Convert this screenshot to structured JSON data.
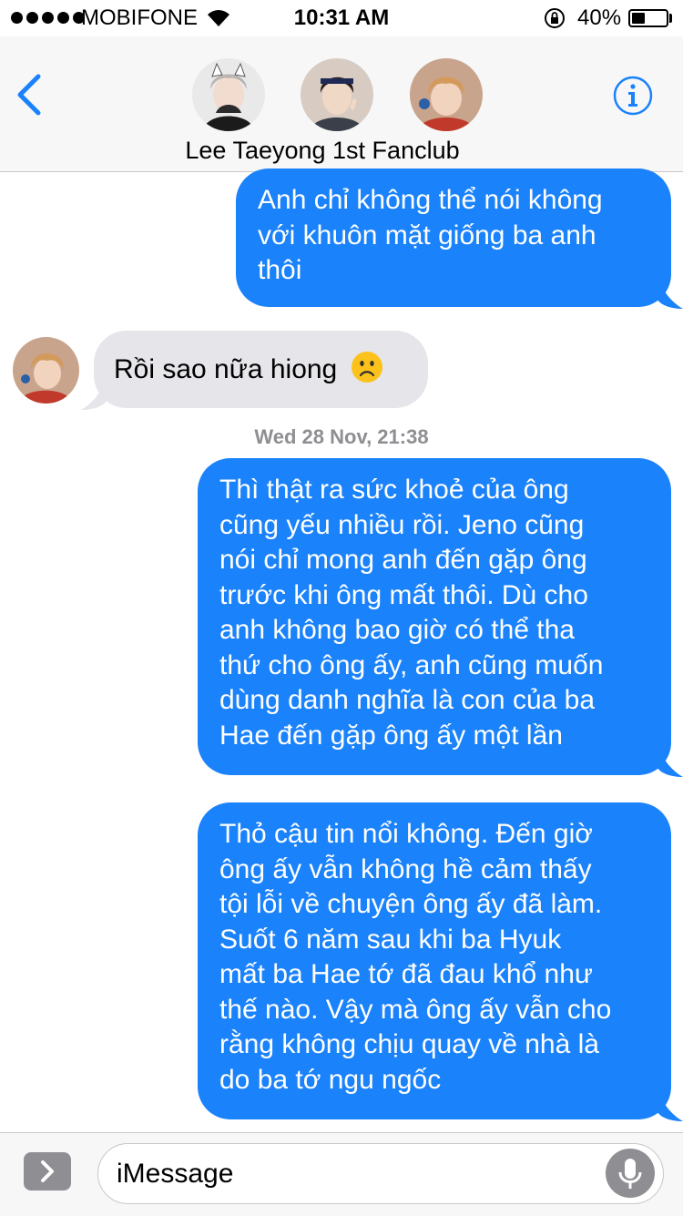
{
  "status_bar": {
    "carrier": "MOBIFONE",
    "time": "10:31 AM",
    "battery": "40%",
    "battery_level": 0.4
  },
  "header": {
    "group_name": "Lee Taeyong 1st Fanclub",
    "back_icon": "chevron-left-icon",
    "info_icon": "info-icon",
    "accent_color": "#1a82fb"
  },
  "messages": [
    {
      "direction": "outgoing",
      "lines": [
        "Anh chỉ không thể nói không",
        "với khuôn mặt giống ba anh",
        "thôi"
      ]
    },
    {
      "direction": "incoming",
      "text": "Rồi sao nữa hiong",
      "emoji": "frowning-face"
    },
    {
      "timestamp": "Wed 28 Nov, 21:38"
    },
    {
      "direction": "outgoing",
      "lines": [
        "Thì thật ra sức khoẻ của ông",
        "cũng yếu nhiều rồi. Jeno cũng",
        "nói chỉ mong anh đến gặp ông",
        "trước khi ông mất thôi. Dù cho",
        "anh không bao giờ có thể tha",
        "thứ cho ông ấy, anh cũng muốn",
        "dùng danh nghĩa là con của ba",
        "Hae đến gặp ông ấy một lần"
      ]
    },
    {
      "direction": "outgoing",
      "lines": [
        "Thỏ cậu tin nổi không. Đến giờ",
        "ông ấy vẫn không hề cảm thấy",
        "tội lỗi về chuyện ông ấy đã làm.",
        "Suốt 6 năm sau khi ba Hyuk",
        "mất ba Hae tớ đã đau khổ như",
        "thế nào. Vậy mà ông ấy vẫn cho",
        "rằng không chịu quay về nhà là",
        "do ba tớ ngu ngốc"
      ]
    }
  ],
  "input": {
    "placeholder": "iMessage",
    "app_icon": "chevron-right-icon",
    "mic_icon": "microphone-icon"
  },
  "colors": {
    "outgoing_bubble": "#1a82fb",
    "incoming_bubble": "#e5e5ea",
    "header_bg": "#f7f7f7"
  }
}
